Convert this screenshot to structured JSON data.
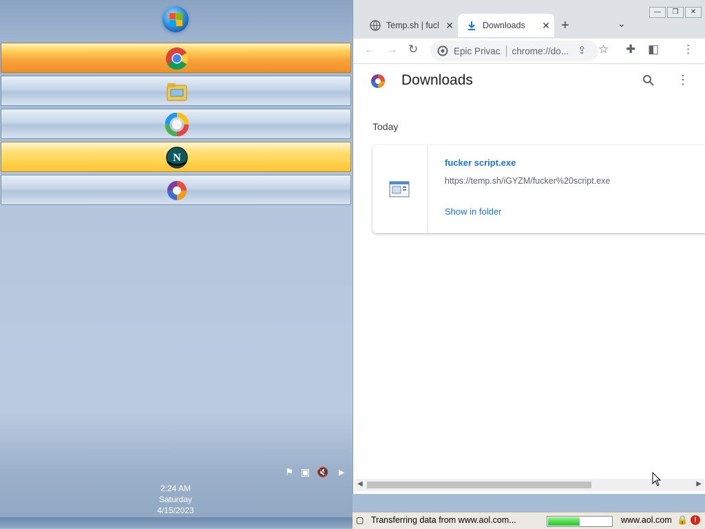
{
  "taskbar": {
    "clock": {
      "time": "2:24 AM",
      "day": "Saturday",
      "date": "4/15/2023"
    },
    "buttons": [
      {
        "icon": "chrome-icon",
        "state": "active"
      },
      {
        "icon": "file-explorer-icon",
        "state": "idle"
      },
      {
        "icon": "colorful-ring-icon",
        "state": "idle"
      },
      {
        "icon": "netscape-icon",
        "state": "pinned"
      },
      {
        "icon": "epic-browser-icon",
        "state": "idle"
      }
    ],
    "tray_icons": [
      "flag-icon",
      "network-icon",
      "speaker-muted-icon",
      "expand-arrow-icon"
    ]
  },
  "browser": {
    "tabs": [
      {
        "title": "Temp.sh | fuck",
        "icon": "globe-icon",
        "active": false
      },
      {
        "title": "Downloads",
        "icon": "download-icon",
        "active": true
      }
    ],
    "address": {
      "site_label": "Epic Privac",
      "url": "chrome://do..."
    },
    "page": {
      "title": "Downloads",
      "section": "Today",
      "download": {
        "file_name": "fucker script.exe",
        "source_url": "https://temp.sh/iGYZM/fucker%20script.exe",
        "action": "Show in folder"
      }
    }
  },
  "statusbar": {
    "text": "Transferring data from www.aol.com...",
    "host": "www.aol.com",
    "progress": 0.5
  },
  "colors": {
    "link": "#1a73e8",
    "active_taskbar": "#f0902a",
    "pinned_taskbar": "#ffd24a"
  }
}
